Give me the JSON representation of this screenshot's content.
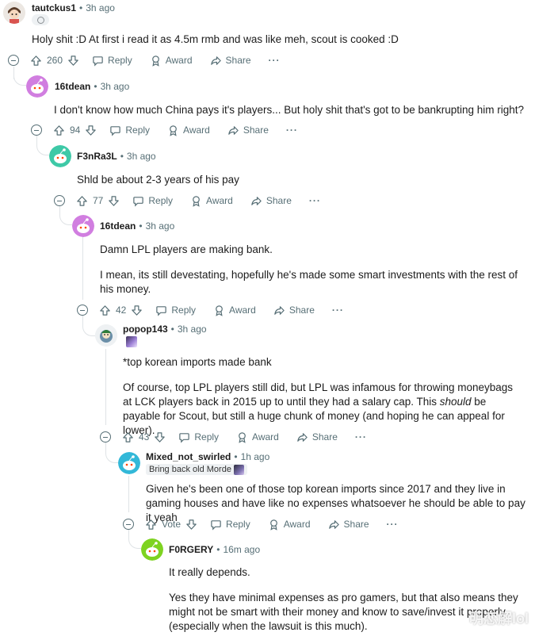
{
  "comments": [
    {
      "author": "tautckus1",
      "time": "3h ago",
      "avatar": "character-avatar",
      "body": [
        "Holy shit :D At first i read it as 4.5m rmb and was like meh, scout is cooked :D"
      ],
      "votes": "260"
    },
    {
      "author": "16tdean",
      "time": "3h ago",
      "avatar": "snoo-purple",
      "body": [
        "I don't know how much China pays it's players... But holy shit that's got to be bankrupting him right?"
      ],
      "votes": "94"
    },
    {
      "author": "F3nRa3L",
      "time": "3h ago",
      "avatar": "snoo-green",
      "body": [
        "Shld be about 2-3 years of his pay"
      ],
      "votes": "77"
    },
    {
      "author": "16tdean",
      "time": "3h ago",
      "avatar": "snoo-purple",
      "body": [
        "Damn LPL players are making bank.",
        "I mean, its still devestating, hopefully he's made some smart investments with the rest of his money."
      ],
      "votes": "42"
    },
    {
      "author": "popop143",
      "time": "3h ago",
      "avatar": "custom-avatar",
      "body": [
        "*top korean imports made bank"
      ],
      "body2_before": "Of course, top LPL players still did, but LPL was infamous for throwing moneybags at LCK players back in 2015 up to until they had a salary cap. This ",
      "body2_em": "should",
      "body2_after": " be payable for Scout, but still a huge chunk of money (and hoping he can appeal for lower).",
      "votes": "43"
    },
    {
      "author": "Mixed_not_swirled",
      "time": "1h ago",
      "avatar": "snoo-teal",
      "flair": "Bring back old Morde",
      "body": [
        "Given he's been one of those top korean imports since 2017 and they live in gaming houses and have like no expenses whatsoever he should be able to pay it yeah"
      ],
      "votes": "Vote"
    },
    {
      "author": "F0RGERY",
      "time": "16m ago",
      "avatar": "snoo-lime",
      "body": [
        "It really depends.",
        "Yes they have minimal expenses as pro gamers, but that also means they might not be smart with their money and know to save/invest it properly (especially when the lawsuit is this much)."
      ]
    }
  ],
  "actions": {
    "reply": "Reply",
    "award": "Award",
    "share": "Share",
    "more": "···"
  },
  "meta_separator": "•",
  "watermark": "明恋解lol",
  "colors": {
    "muted": "#576f76",
    "thread_line": "#dfe3e6",
    "snoo_purple": "#d17ee0",
    "snoo_green": "#3ec9a7",
    "snoo_teal": "#33b8d8",
    "snoo_lime": "#7ed321"
  }
}
